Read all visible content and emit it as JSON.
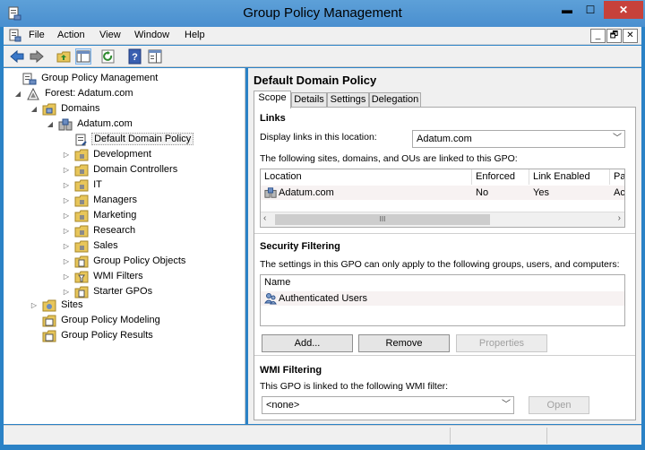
{
  "window": {
    "title": "Group Policy Management",
    "controls": {
      "minimize": "▬",
      "maximize": "☐",
      "close": "✕"
    }
  },
  "menubar": {
    "items": [
      "File",
      "Action",
      "View",
      "Window",
      "Help"
    ],
    "mdi_controls": {
      "minimize": "_",
      "restore": "🗗",
      "close": "✕"
    }
  },
  "toolbar": {
    "buttons": [
      "back-icon",
      "forward-icon",
      "folder-up-icon",
      "show-hide-tree-icon",
      "refresh-icon",
      "help-icon",
      "properties-pane-icon"
    ]
  },
  "tree": {
    "items": [
      {
        "label": "Group Policy Management",
        "icon": "gpm-console-icon",
        "expander": "",
        "level": 0
      },
      {
        "label": "Forest: Adatum.com",
        "icon": "forest-icon",
        "expander": "◢",
        "level": 1
      },
      {
        "label": "Domains",
        "icon": "folder-icon",
        "expander": "◢",
        "level": 2
      },
      {
        "label": "Adatum.com",
        "icon": "domain-icon",
        "expander": "◢",
        "level": 3
      },
      {
        "label": "Default Domain Policy",
        "icon": "gpo-link-icon",
        "expander": "",
        "level": 4,
        "selected": true
      },
      {
        "label": "Development",
        "icon": "ou-icon",
        "expander": "▷",
        "level": 4
      },
      {
        "label": "Domain Controllers",
        "icon": "ou-icon",
        "expander": "▷",
        "level": 4
      },
      {
        "label": "IT",
        "icon": "ou-icon",
        "expander": "▷",
        "level": 4
      },
      {
        "label": "Managers",
        "icon": "ou-icon",
        "expander": "▷",
        "level": 4
      },
      {
        "label": "Marketing",
        "icon": "ou-icon",
        "expander": "▷",
        "level": 4
      },
      {
        "label": "Research",
        "icon": "ou-icon",
        "expander": "▷",
        "level": 4
      },
      {
        "label": "Sales",
        "icon": "ou-icon",
        "expander": "▷",
        "level": 4
      },
      {
        "label": "Group Policy Objects",
        "icon": "folder-icon",
        "expander": "▷",
        "level": 4
      },
      {
        "label": "WMI Filters",
        "icon": "folder-icon",
        "expander": "▷",
        "level": 4
      },
      {
        "label": "Starter GPOs",
        "icon": "folder-icon",
        "expander": "▷",
        "level": 4
      },
      {
        "label": "Sites",
        "icon": "sites-icon",
        "expander": "▷",
        "level": 1
      },
      {
        "label": "Group Policy Modeling",
        "icon": "modeling-icon",
        "expander": "",
        "level": 1
      },
      {
        "label": "Group Policy Results",
        "icon": "results-icon",
        "expander": "",
        "level": 1
      }
    ]
  },
  "details": {
    "title": "Default Domain Policy",
    "tabs": [
      "Scope",
      "Details",
      "Settings",
      "Delegation"
    ],
    "active_tab": "Scope",
    "links": {
      "heading": "Links",
      "display_label": "Display links in this location:",
      "display_value": "Adatum.com",
      "description": "The following sites, domains, and OUs are linked to this GPO:",
      "columns": [
        "Location",
        "Enforced",
        "Link Enabled",
        "Pa"
      ],
      "rows": [
        {
          "location": "Adatum.com",
          "enforced": "No",
          "link_enabled": "Yes",
          "path": "Ac"
        }
      ],
      "scroll_thumb": "III"
    },
    "security": {
      "heading": "Security Filtering",
      "description": "The settings in this GPO can only apply to the following groups, users, and computers:",
      "column": "Name",
      "rows": [
        "Authenticated Users"
      ],
      "add_label": "Add...",
      "remove_label": "Remove",
      "properties_label": "Properties"
    },
    "wmi": {
      "heading": "WMI Filtering",
      "description": "This GPO is linked to the following WMI filter:",
      "value": "<none>",
      "open_label": "Open"
    }
  }
}
